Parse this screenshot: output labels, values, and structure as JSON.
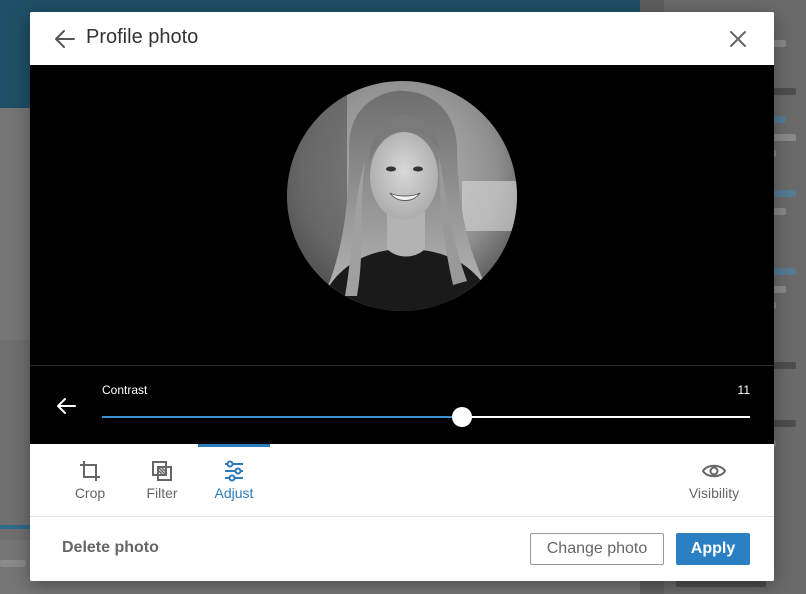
{
  "modal": {
    "title": "Profile photo",
    "back_icon": "arrow-left-icon",
    "close_icon": "close-icon"
  },
  "photo": {
    "alt": "Profile photo of a smiling woman with long hair, black and white",
    "filter": "grayscale"
  },
  "adjust": {
    "label": "Contrast",
    "value": "11",
    "fraction": 0.555
  },
  "tools": {
    "crop": {
      "label": "Crop",
      "icon": "crop-icon"
    },
    "filter": {
      "label": "Filter",
      "icon": "filter-icon"
    },
    "adjust": {
      "label": "Adjust",
      "icon": "adjust-sliders-icon",
      "active": true
    },
    "visibility": {
      "label": "Visibility",
      "icon": "eye-icon"
    }
  },
  "footer": {
    "delete_label": "Delete photo",
    "change_label": "Change photo",
    "apply_label": "Apply"
  },
  "colors": {
    "accent": "#2b7bb9",
    "apply_bg": "#2b80c4",
    "stage_bg": "#000000"
  }
}
